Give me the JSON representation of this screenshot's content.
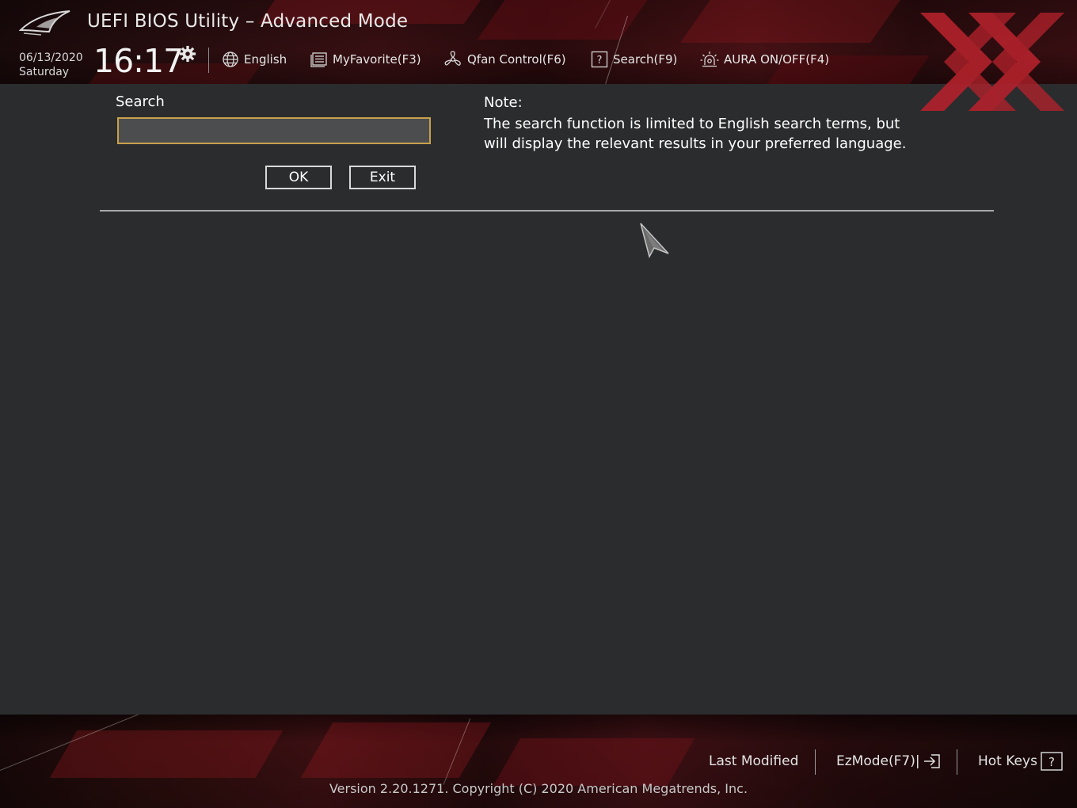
{
  "header": {
    "title": "UEFI BIOS Utility – Advanced Mode",
    "date": "06/13/2020",
    "weekday": "Saturday",
    "time": "16:17",
    "toolbar": {
      "language": "English",
      "my_favorite": "MyFavorite(F3)",
      "qfan": "Qfan Control(F6)",
      "search": "Search(F9)",
      "aura": "AURA ON/OFF(F4)"
    }
  },
  "search_panel": {
    "label": "Search",
    "input_value": "",
    "ok_label": "OK",
    "exit_label": "Exit",
    "note_title": "Note:",
    "note_body": "The search function is limited to English search terms, but will display the relevant results in your preferred language."
  },
  "footer": {
    "last_modified": "Last Modified",
    "ezmode": "EzMode(F7)|",
    "hot_keys": "Hot Keys",
    "version": "Version 2.20.1271. Copyright (C) 2020 American Megatrends, Inc."
  },
  "icons": {
    "logo": "rog-eye-icon",
    "clock_settings": "gear-icon",
    "language": "globe-icon",
    "favorite": "list-icon",
    "qfan": "fan-icon",
    "search": "question-box-icon",
    "aura": "light-icon",
    "ezmode": "exit-arrow-icon",
    "hot_keys": "question-box-icon"
  },
  "colors": {
    "background": "#2b2c2e",
    "accent_red": "#b3222c",
    "input_border": "#c8a14a",
    "input_fill": "#4c4d4f"
  }
}
